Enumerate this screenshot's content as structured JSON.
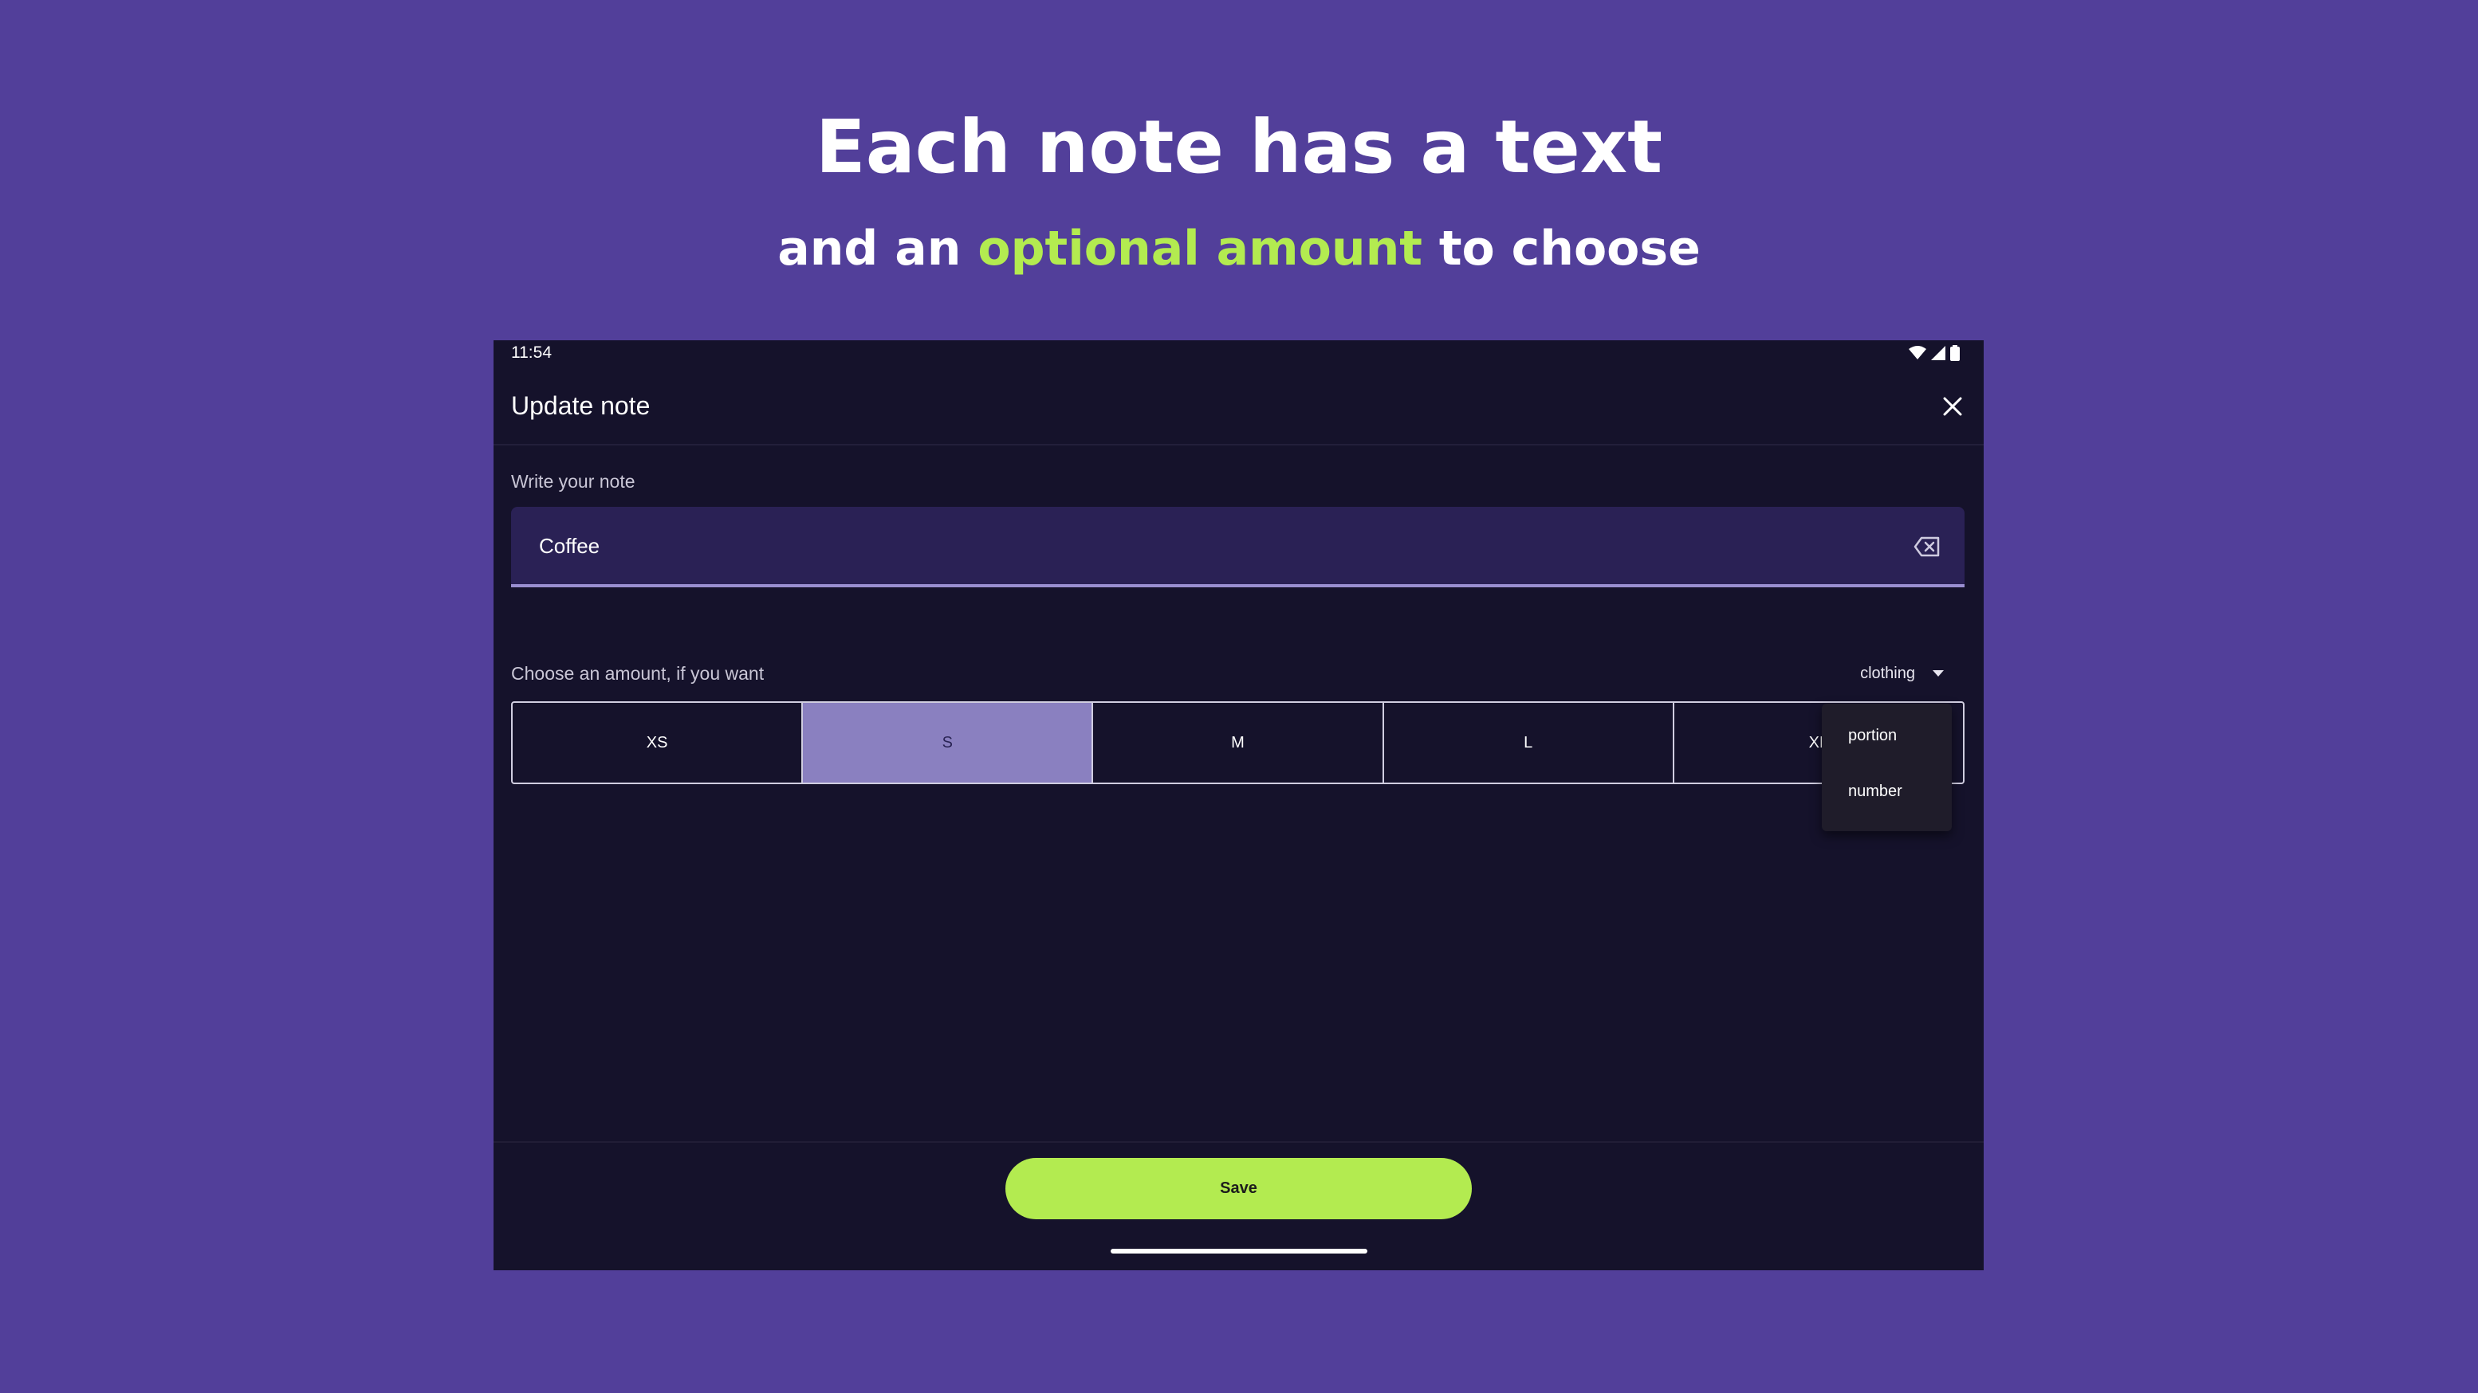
{
  "promo": {
    "headline": "Each note has a text",
    "sub_prefix": "and an ",
    "sub_accent": "optional amount",
    "sub_suffix": " to choose"
  },
  "status_bar": {
    "time": "11:54",
    "icons": [
      "wifi-icon",
      "cellular-signal-icon",
      "battery-icon"
    ]
  },
  "app_bar": {
    "title": "Update note",
    "close_icon": "close-icon"
  },
  "note": {
    "label": "Write your note",
    "value": "Coffee",
    "clear_icon": "backspace-clear-icon"
  },
  "amount": {
    "label": "Choose an amount, if you want",
    "unit_selected": "clothing",
    "unit_options": [
      "portion",
      "number"
    ],
    "sizes": [
      "XS",
      "S",
      "M",
      "L",
      "XL"
    ],
    "selected_size": "S"
  },
  "actions": {
    "save_label": "Save"
  },
  "colors": {
    "promo_background": "#523f9a",
    "accent_green": "#b3eb50",
    "app_background": "#15122b",
    "input_background": "#2a2155",
    "selected_segment": "#8a80c0"
  }
}
